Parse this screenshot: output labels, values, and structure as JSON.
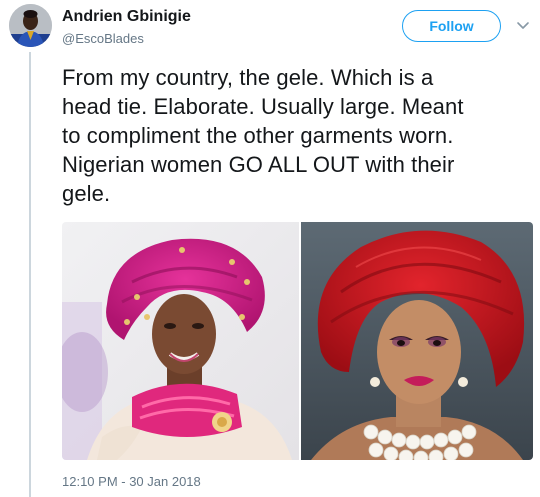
{
  "author": {
    "display_name": "Andrien Gbinigie",
    "handle": "@EscoBlades"
  },
  "follow_button": {
    "label": "Follow"
  },
  "tweet": {
    "lines": [
      "From my country, the gele. Which is a",
      "head tie. Elaborate. Usually large. Meant",
      "to compliment the other garments worn.",
      "Nigerian women GO ALL OUT with their",
      "gele."
    ],
    "timestamp": "12:10 PM - 30 Jan 2018"
  },
  "colors": {
    "accent": "#1da1f2",
    "secondary_text": "#657786",
    "thread_line": "#ccd6dd"
  },
  "icons": {
    "more_menu": "chevron-down-icon"
  }
}
